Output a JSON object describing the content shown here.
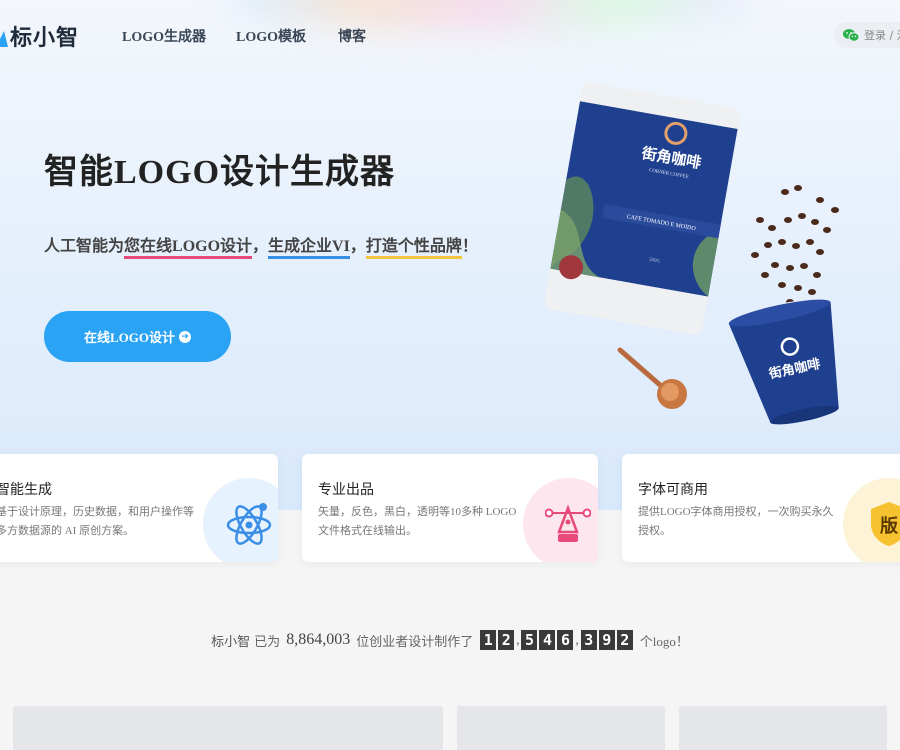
{
  "header": {
    "brand": "标小智",
    "nav": [
      "LOGO生成器",
      "LOGO模板",
      "博客"
    ],
    "login": "登录 / 注"
  },
  "hero": {
    "title": "智能LOGO设计生成器",
    "subtitle": {
      "prefix": "人工智能为",
      "part1": "您在线LOGO设计",
      "sep1": "，",
      "part2": "生成企业VI",
      "sep2": "，",
      "part3": "打造个性品牌",
      "suffix": "！"
    },
    "cta": "在线LOGO设计"
  },
  "product": {
    "bag_brand": "街角咖啡",
    "bag_sub": "CORNER COFFEE",
    "bag_label": "CAFE TOMADO E MOIDO",
    "bag_weight": "500G",
    "cup_brand": "街角咖啡"
  },
  "features": [
    {
      "title": "智能生成",
      "desc": "基于设计原理，历史数据，和用户操作等多方数据源的 AI 原创方案。",
      "icon": "atom-icon"
    },
    {
      "title": "专业出品",
      "desc": "矢量，反色，黑白，透明等10多种 LOGO 文件格式在线输出。",
      "icon": "pen-tool-icon"
    },
    {
      "title": "字体可商用",
      "desc": "提供LOGO字体商用授权，一次购买永久授权。",
      "icon": "copyright-badge-icon",
      "badge": "版"
    }
  ],
  "stats": {
    "brand": "标小智",
    "text1": "已为",
    "users": "8,864,003",
    "text2": "位创业者设计制作了",
    "digits": [
      "1",
      "2",
      ",",
      "5",
      "4",
      "6",
      ",",
      "3",
      "9",
      "2"
    ],
    "text3": "个logo！"
  },
  "colors": {
    "accent": "#2aa3f5",
    "underline1": "#e84a7a",
    "underline2": "#3a8ee6",
    "underline3": "#f5c542",
    "bag_blue": "#1f3f8f"
  }
}
